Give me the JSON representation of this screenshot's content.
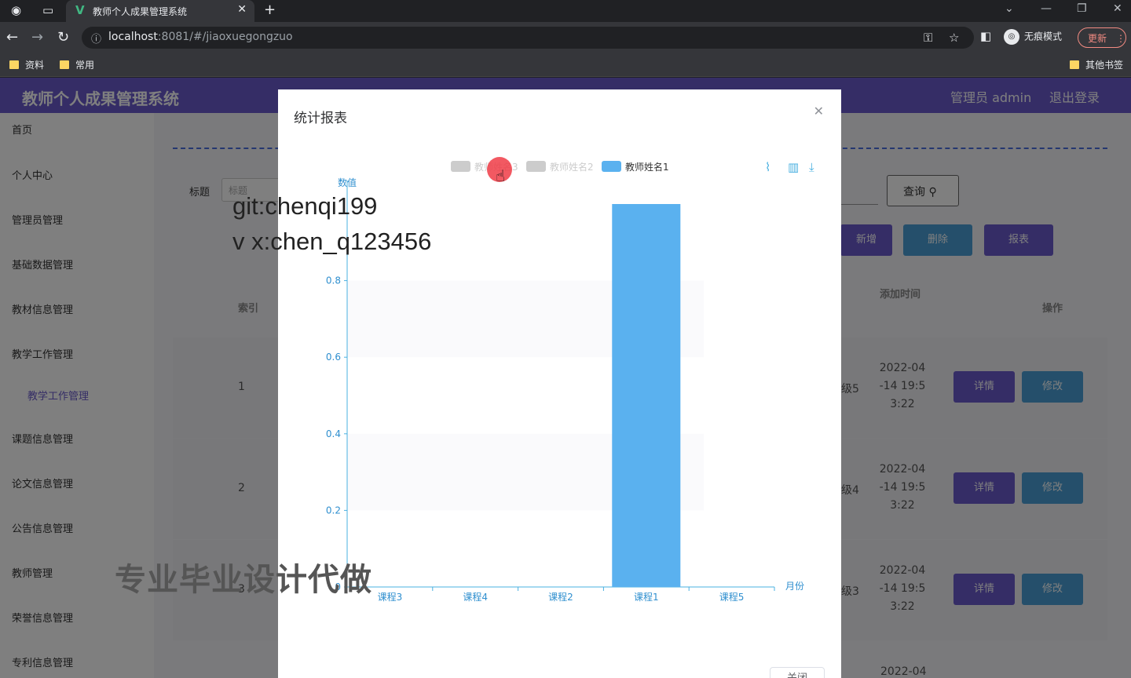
{
  "browser": {
    "tab_title": "教师个人成果管理系统",
    "url_host": "localhost",
    "url_path": ":8081/#/jiaoxuegongzuo",
    "incognito_label": "无痕模式",
    "update_label": "更新",
    "bookmarks": [
      "资料",
      "常用"
    ],
    "other_bookmarks": "其他书签"
  },
  "app": {
    "title": "教师个人成果管理系统",
    "user": "管理员 admin",
    "logout": "退出登录",
    "sidebar": [
      "首页",
      "个人中心",
      "管理员管理",
      "基础数据管理",
      "教材信息管理",
      "教学工作管理",
      "教学工作管理",
      "课题信息管理",
      "论文信息管理",
      "公告信息管理",
      "教师管理",
      "荣誉信息管理",
      "专利信息管理"
    ],
    "search_label": "标题",
    "search_placeholder": "标题",
    "query_button": "查询",
    "buttons": {
      "add": "新增",
      "delete": "删除",
      "report": "报表"
    },
    "table_headers": {
      "index": "索引",
      "added_time": "添加时间",
      "actions": "操作"
    },
    "rows": [
      {
        "index": "1",
        "partial": "级5",
        "date": [
          "2022-04",
          "-14 19:5",
          "3:22"
        ]
      },
      {
        "index": "2",
        "partial": "级4",
        "date": [
          "2022-04",
          "-14 19:5",
          "3:22"
        ]
      },
      {
        "index": "3",
        "partial": "级3",
        "date": [
          "2022-04",
          "-14 19:5",
          "3:22"
        ]
      }
    ],
    "last_row_date": "2022-04",
    "detail_label": "详情",
    "edit_label": "修改"
  },
  "modal": {
    "title": "统计报表",
    "footer_button": "关闭",
    "legend": [
      "教师姓名3",
      "教师姓名2",
      "教师姓名1"
    ]
  },
  "chart_data": {
    "type": "bar",
    "ylabel": "数值",
    "xlabel": "月份",
    "categories": [
      "课程3",
      "课程4",
      "课程2",
      "课程1",
      "课程5"
    ],
    "ylim": [
      0,
      1
    ],
    "yticks": [
      "0",
      "0.2",
      "0.4",
      "0.6",
      "0.8"
    ],
    "series": [
      {
        "name": "教师姓名3",
        "values": [
          0,
          0,
          0,
          0,
          0
        ],
        "active": false
      },
      {
        "name": "教师姓名2",
        "values": [
          0,
          0,
          0,
          0,
          0
        ],
        "active": false
      },
      {
        "name": "教师姓名1",
        "values": [
          0,
          0,
          0,
          1,
          0
        ],
        "active": true,
        "color": "#5ab1ef"
      }
    ]
  },
  "watermarks": [
    "git:chenqi199",
    "v x:chen_q123456",
    "专业毕业设计代做"
  ],
  "colors": {
    "primary": "#6a5acd",
    "info": "#4a9fd6",
    "bar": "#5ab1ef"
  }
}
